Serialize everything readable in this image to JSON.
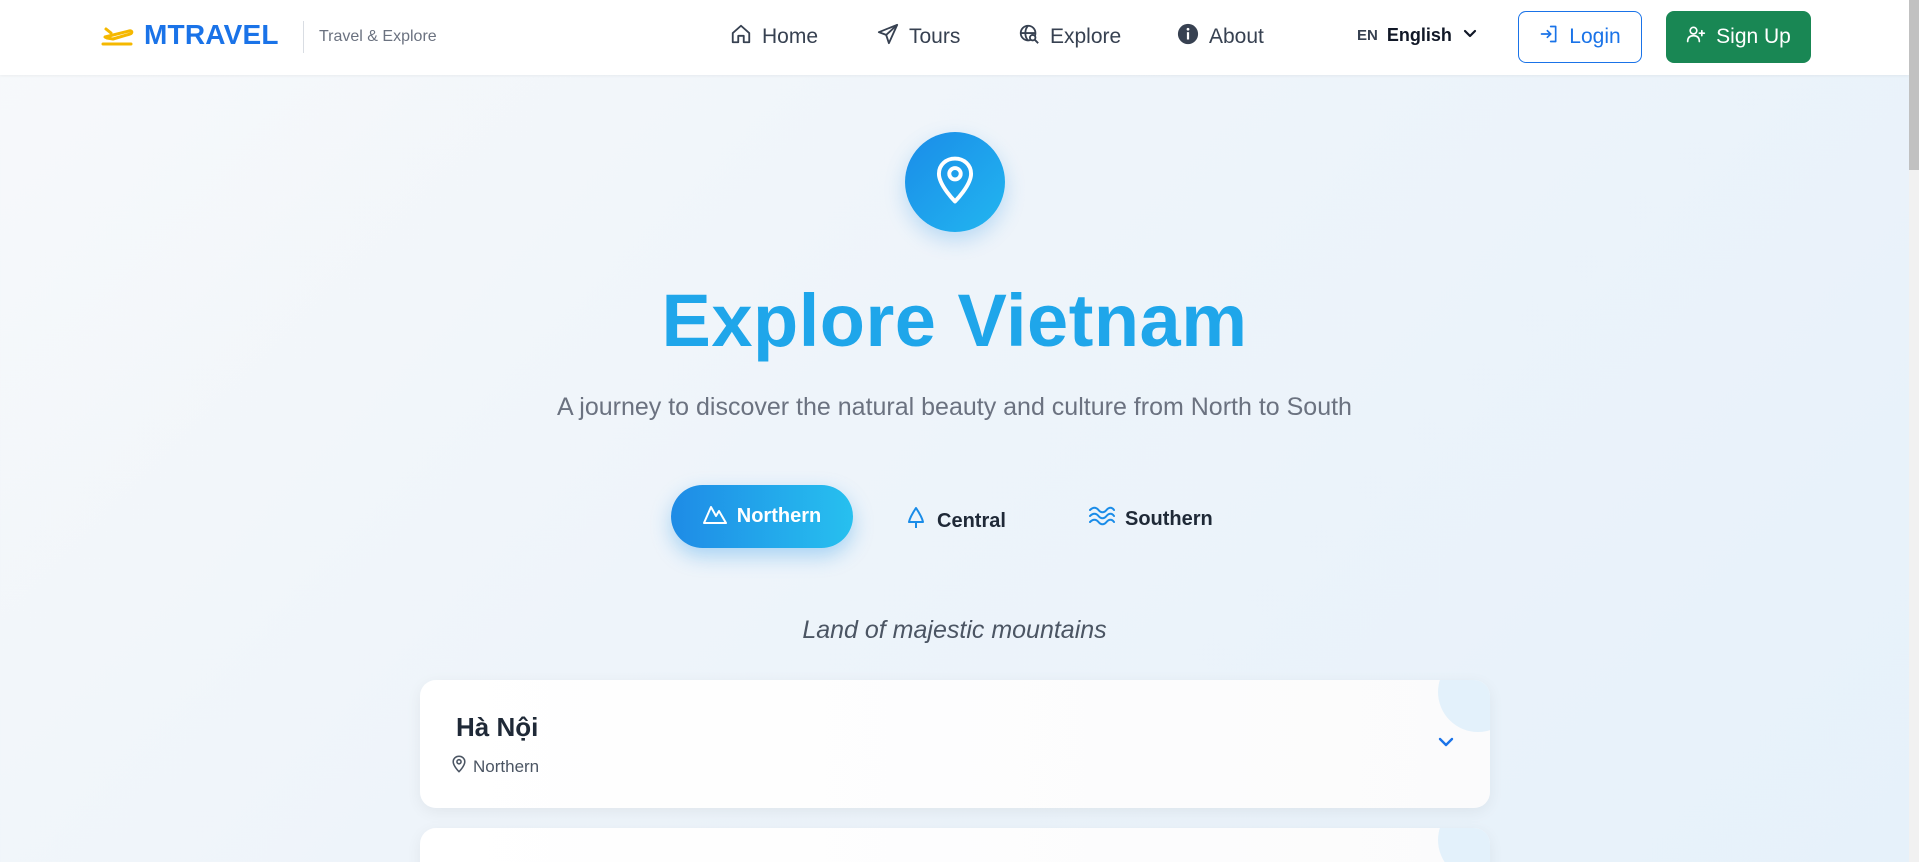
{
  "header": {
    "brand_name": "MTRAVEL",
    "brand_icon": "plane-icon",
    "tagline": "Travel & Explore",
    "nav": [
      {
        "label": "Home",
        "icon": "home-icon"
      },
      {
        "label": "Tours",
        "icon": "send-icon"
      },
      {
        "label": "Explore",
        "icon": "globe-search-icon"
      },
      {
        "label": "About",
        "icon": "info-icon"
      }
    ],
    "language": {
      "code": "EN",
      "name": "English"
    },
    "login_label": "Login",
    "signup_label": "Sign Up"
  },
  "hero": {
    "icon": "map-pin-icon",
    "title": "Explore Vietnam",
    "subtitle": "A journey to discover the natural beauty and culture from North to South"
  },
  "regions": {
    "tabs": [
      {
        "label": "Northern",
        "icon": "mountain-icon",
        "active": true
      },
      {
        "label": "Central",
        "icon": "tree-icon",
        "active": false
      },
      {
        "label": "Southern",
        "icon": "waves-icon",
        "active": false
      }
    ],
    "caption": "Land of majestic mountains"
  },
  "destinations": [
    {
      "name": "Hà Nội",
      "region": "Northern"
    }
  ],
  "colors": {
    "brand_blue": "#1a73e8",
    "hero_blue": "#1fa6ea",
    "signup_green": "#198754",
    "brand_icon_yellow": "#f5b800"
  }
}
